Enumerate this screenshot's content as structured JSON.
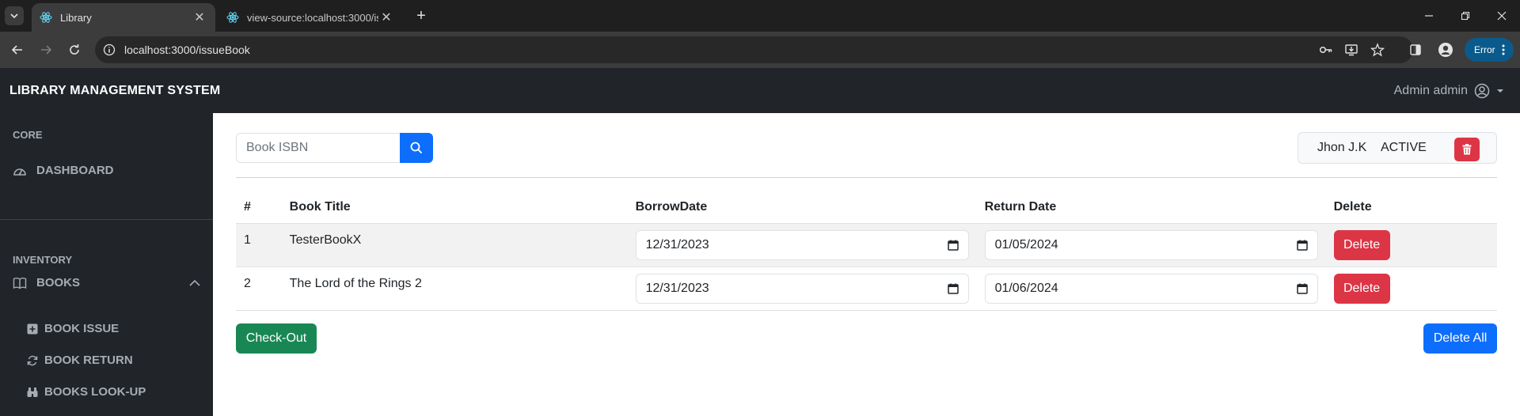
{
  "browser": {
    "tabs": [
      {
        "title": "Library",
        "active": true
      },
      {
        "title": "view-source:localhost:3000/issu",
        "active": false
      }
    ],
    "url": "localhost:3000/issueBook",
    "error_label": "Error"
  },
  "app": {
    "brand": "LIBRARY MANAGEMENT SYSTEM",
    "user": "Admin admin"
  },
  "sidebar": {
    "core_heading": "CORE",
    "dashboard": "DASHBOARD",
    "inventory_heading": "INVENTORY",
    "books": "BOOKS",
    "sub_items": [
      {
        "label": "BOOK ISSUE",
        "icon": "plus-square-icon"
      },
      {
        "label": "BOOK RETURN",
        "icon": "refresh-icon"
      },
      {
        "label": "BOOKS LOOK-UP",
        "icon": "binoculars-icon"
      }
    ]
  },
  "search": {
    "placeholder": "Book ISBN"
  },
  "member": {
    "name": "Jhon J.K",
    "status": "ACTIVE"
  },
  "table": {
    "headers": [
      "#",
      "Book Title",
      "BorrowDate",
      "Return Date",
      "Delete"
    ],
    "rows": [
      {
        "num": "1",
        "title": "TesterBookX",
        "borrow": "12/31/2023",
        "return": "01/05/2024",
        "delete_label": "Delete"
      },
      {
        "num": "2",
        "title": "The Lord of the Rings 2",
        "borrow": "12/31/2023",
        "return": "01/06/2024",
        "delete_label": "Delete"
      }
    ]
  },
  "actions": {
    "checkout": "Check-Out",
    "delete_all": "Delete All"
  },
  "colors": {
    "primary": "#0d6efd",
    "danger": "#dc3545",
    "success": "#198754",
    "dark": "#212529"
  }
}
